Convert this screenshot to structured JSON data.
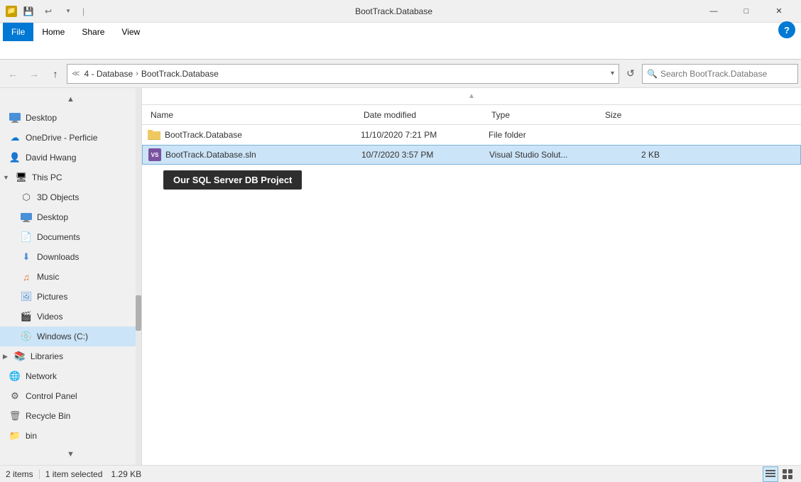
{
  "window": {
    "title": "BootTrack.Database",
    "icon": "📁"
  },
  "titlebar": {
    "minimize": "—",
    "maximize": "□",
    "close": "✕",
    "qat_save": "💾",
    "qat_undo": "↩",
    "qat_dropdown": "▾"
  },
  "ribbon": {
    "tabs": [
      "File",
      "Home",
      "Share",
      "View"
    ],
    "active_tab": "File",
    "help": "?",
    "expand_icon": "▾"
  },
  "addressbar": {
    "back": "←",
    "forward": "→",
    "up": "↑",
    "crumb1": "4 - Database",
    "crumb2": "BootTrack.Database",
    "dropdown": "▾",
    "refresh": "↺",
    "search_placeholder": "Search BootTrack.Database",
    "search_icon": "🔍"
  },
  "sidebar": {
    "scroll_up": "▲",
    "scroll_down": "▼",
    "items": [
      {
        "id": "desktop",
        "label": "Desktop",
        "icon": "desktop",
        "indent": 1
      },
      {
        "id": "onedrive",
        "label": "OneDrive - Perficie",
        "icon": "cloud",
        "indent": 1
      },
      {
        "id": "david",
        "label": "David Hwang",
        "icon": "user",
        "indent": 1
      },
      {
        "id": "thispc",
        "label": "This PC",
        "icon": "pc",
        "indent": 1
      },
      {
        "id": "3dobjects",
        "label": "3D Objects",
        "icon": "cube",
        "indent": 2
      },
      {
        "id": "desktop2",
        "label": "Desktop",
        "icon": "folder",
        "indent": 2
      },
      {
        "id": "documents",
        "label": "Documents",
        "icon": "doc",
        "indent": 2
      },
      {
        "id": "downloads",
        "label": "Downloads",
        "icon": "down",
        "indent": 2
      },
      {
        "id": "music",
        "label": "Music",
        "icon": "music",
        "indent": 2
      },
      {
        "id": "pictures",
        "label": "Pictures",
        "icon": "pic",
        "indent": 2
      },
      {
        "id": "videos",
        "label": "Videos",
        "icon": "vid",
        "indent": 2
      },
      {
        "id": "windows",
        "label": "Windows (C:)",
        "icon": "drive",
        "indent": 2,
        "active": true
      },
      {
        "id": "libraries",
        "label": "Libraries",
        "icon": "lib",
        "indent": 1
      },
      {
        "id": "network",
        "label": "Network",
        "icon": "net",
        "indent": 1
      },
      {
        "id": "controlpanel",
        "label": "Control Panel",
        "icon": "ctrl",
        "indent": 1
      },
      {
        "id": "recyclebin",
        "label": "Recycle Bin",
        "icon": "recycle",
        "indent": 1
      },
      {
        "id": "bin",
        "label": "bin",
        "icon": "folder",
        "indent": 1
      }
    ]
  },
  "content": {
    "columns": [
      {
        "id": "name",
        "label": "Name"
      },
      {
        "id": "date",
        "label": "Date modified"
      },
      {
        "id": "type",
        "label": "Type"
      },
      {
        "id": "size",
        "label": "Size"
      }
    ],
    "files": [
      {
        "name": "BootTrack.Database",
        "date": "11/10/2020 7:21 PM",
        "type": "File folder",
        "size": "",
        "icon": "folder",
        "selected": false
      },
      {
        "name": "BootTrack.Database.sln",
        "date": "10/7/2020 3:57 PM",
        "type": "Visual Studio Solut...",
        "size": "2 KB",
        "icon": "sln",
        "selected": true
      }
    ],
    "callout": "Our SQL Server DB Project"
  },
  "statusbar": {
    "count": "2 items",
    "selected": "1 item selected",
    "size": "1.29 KB"
  }
}
